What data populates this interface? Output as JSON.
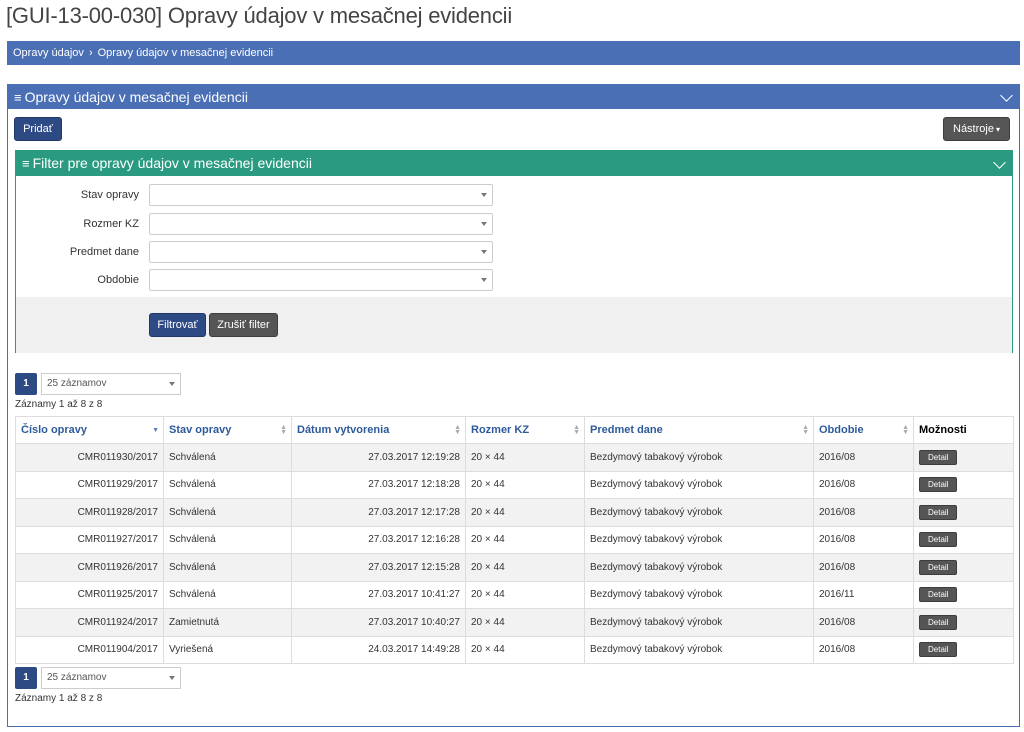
{
  "title": "[GUI-13-00-030] Opravy údajov v mesačnej evidencii",
  "breadcrumb": {
    "items": [
      "Opravy údajov",
      "Opravy údajov v mesačnej evidencii"
    ],
    "separator": "›"
  },
  "panel": {
    "title": "Opravy údajov v mesačnej evidencii",
    "add_label": "Pridať",
    "tools_label": "Nástroje"
  },
  "filter": {
    "title": "Filter pre opravy údajov v mesačnej evidencii",
    "fields": [
      {
        "label": "Stav opravy",
        "value": ""
      },
      {
        "label": "Rozmer KZ",
        "value": ""
      },
      {
        "label": "Predmet dane",
        "value": ""
      },
      {
        "label": "Obdobie",
        "value": ""
      }
    ],
    "apply_label": "Filtrovať",
    "clear_label": "Zrušiť filter"
  },
  "pagination": {
    "page": "1",
    "page_size": "25 záznamov",
    "records_text": "Záznamy 1 až 8 z 8"
  },
  "table": {
    "columns": [
      "Číslo opravy",
      "Stav opravy",
      "Dátum vytvorenia",
      "Rozmer KZ",
      "Predmet dane",
      "Obdobie",
      "Možnosti"
    ],
    "sorted_column": "Číslo opravy",
    "sort_direction": "desc",
    "detail_label": "Detail",
    "rows": [
      [
        "CMR011930/2017",
        "Schválená",
        "27.03.2017 12:19:28",
        "20 × 44",
        "Bezdymový tabakový výrobok",
        "2016/08"
      ],
      [
        "CMR011929/2017",
        "Schválená",
        "27.03.2017 12:18:28",
        "20 × 44",
        "Bezdymový tabakový výrobok",
        "2016/08"
      ],
      [
        "CMR011928/2017",
        "Schválená",
        "27.03.2017 12:17:28",
        "20 × 44",
        "Bezdymový tabakový výrobok",
        "2016/08"
      ],
      [
        "CMR011927/2017",
        "Schválená",
        "27.03.2017 12:16:28",
        "20 × 44",
        "Bezdymový tabakový výrobok",
        "2016/08"
      ],
      [
        "CMR011926/2017",
        "Schválená",
        "27.03.2017 12:15:28",
        "20 × 44",
        "Bezdymový tabakový výrobok",
        "2016/08"
      ],
      [
        "CMR011925/2017",
        "Schválená",
        "27.03.2017 10:41:27",
        "20 × 44",
        "Bezdymový tabakový výrobok",
        "2016/11"
      ],
      [
        "CMR011924/2017",
        "Zamietnutá",
        "27.03.2017 10:40:27",
        "20 × 44",
        "Bezdymový tabakový výrobok",
        "2016/08"
      ],
      [
        "CMR011904/2017",
        "Vyriešená",
        "24.03.2017 14:49:28",
        "20 × 44",
        "Bezdymový tabakový výrobok",
        "2016/08"
      ]
    ]
  },
  "colors": {
    "primary": "#4a6fb5",
    "button": "#2e4a85",
    "filter": "#2a9a80",
    "dark_button": "#555555"
  },
  "icons": {
    "menu": "hamburger-icon",
    "collapse": "chevron-down-icon",
    "sort": "sort-icon"
  }
}
